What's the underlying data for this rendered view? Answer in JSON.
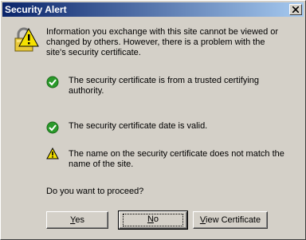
{
  "dialog": {
    "title": "Security Alert",
    "intro": "Information you exchange with this site cannot be viewed or changed by others. However, there is a problem with the site's security certificate.",
    "items": [
      {
        "status": "ok",
        "text": "The security certificate is from a trusted certifying authority."
      },
      {
        "status": "ok",
        "text": "The security certificate date is valid."
      },
      {
        "status": "warning",
        "text": "The name on the security certificate does not match the name of the site."
      }
    ],
    "question": "Do you want to proceed?",
    "buttons": {
      "yes_first": "Y",
      "yes_rest": "es",
      "no_first": "N",
      "no_rest": "o",
      "view_first": "V",
      "view_rest": "iew Certificate"
    }
  },
  "colors": {
    "ok": "#2a9a2a",
    "warning": "#f5e100",
    "title_bar": "#0a246a"
  },
  "icons": {
    "title": "lock-warning-icon",
    "ok": "check-circle-icon",
    "warning": "warning-triangle-icon"
  }
}
